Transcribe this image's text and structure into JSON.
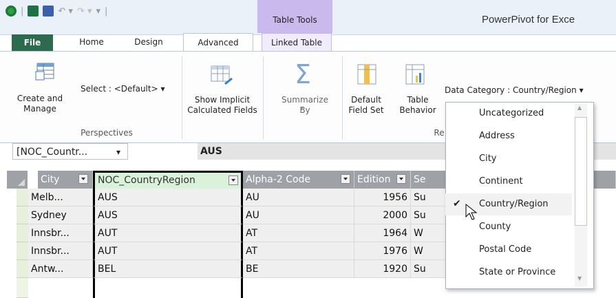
{
  "title_bar": {
    "context_tab_group": "Table Tools",
    "app_title": "PowerPivot for Exce"
  },
  "tabs": [
    "File",
    "Home",
    "Design",
    "Advanced",
    "Linked Table"
  ],
  "ribbon": {
    "create_manage": "Create and Manage",
    "select_default": "Select : <Default>",
    "perspectives_group": "Perspectives",
    "show_implicit": "Show Implicit Calculated Fields",
    "summarize_by": "Summarize By",
    "default_field_set": "Default Field Set",
    "table_behavior": "Table Behavior",
    "reporting_group_partial": "Re",
    "data_category": "Data Category : Country/Region"
  },
  "formula_bar": {
    "name_box": "[NOC_Countr...",
    "value": "AUS"
  },
  "grid": {
    "columns": [
      "City",
      "NOC_CountryRegion",
      "Alpha-2 Code",
      "Edition",
      "Se"
    ],
    "rows": [
      {
        "city": "Melb...",
        "noc": "AUS",
        "alpha2": "AU",
        "edition": "1956",
        "season": "Su"
      },
      {
        "city": "Sydney",
        "noc": "AUS",
        "alpha2": "AU",
        "edition": "2000",
        "season": "Su"
      },
      {
        "city": "Innsbr...",
        "noc": "AUT",
        "alpha2": "AT",
        "edition": "1964",
        "season": "W"
      },
      {
        "city": "Innsbr...",
        "noc": "AUT",
        "alpha2": "AT",
        "edition": "1976",
        "season": "W"
      },
      {
        "city": "Antw...",
        "noc": "BEL",
        "alpha2": "BE",
        "edition": "1920",
        "season": "Su"
      }
    ]
  },
  "dropdown": {
    "items": [
      "Uncategorized",
      "Address",
      "City",
      "Continent",
      "Country/Region",
      "County",
      "Postal Code",
      "State or Province"
    ],
    "selected": "Country/Region"
  },
  "colors": {
    "header_bg": "#9ea1a5",
    "file_tab": "#2c6b4e",
    "context_tab": "#c9b9ec",
    "selected_header": "#d9f2d9"
  }
}
